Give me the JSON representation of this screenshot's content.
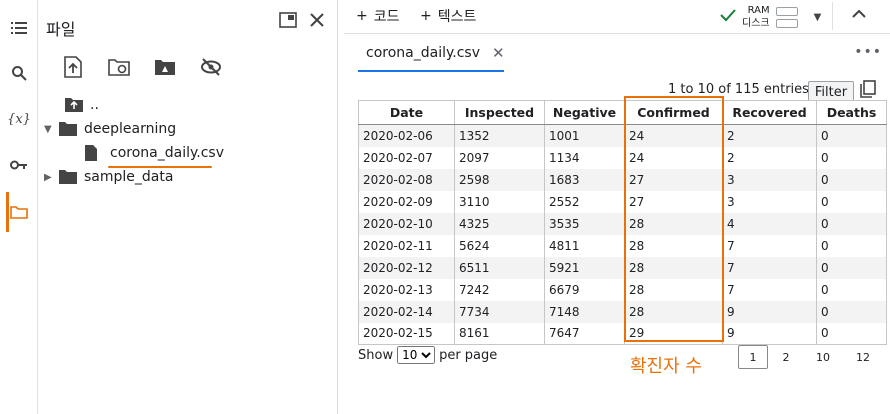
{
  "rail": {
    "icons": [
      "list-icon",
      "search-icon",
      "variables-icon",
      "key-icon",
      "folder-icon"
    ],
    "variables_label": "{x}",
    "accent": "#e8710a"
  },
  "files": {
    "title": "파일",
    "tree": [
      {
        "label": "..",
        "type": "parent"
      },
      {
        "label": "deeplearning",
        "type": "folder",
        "expanded": true
      },
      {
        "label": "corona_daily.csv",
        "type": "file"
      },
      {
        "label": "sample_data",
        "type": "folder",
        "expanded": false
      }
    ]
  },
  "topbar": {
    "code_label": "코드",
    "text_label": "텍스트",
    "ram_label": "RAM",
    "disk_label": "디스크"
  },
  "tab": {
    "label": "corona_daily.csv"
  },
  "table": {
    "entries_text": "1 to 10 of 115 entries",
    "filter_label": "Filter",
    "columns": [
      "Date",
      "Inspected",
      "Negative",
      "Confirmed",
      "Recovered",
      "Deaths"
    ],
    "rows": [
      [
        "2020-02-06",
        "1352",
        "1001",
        "24",
        "2",
        "0"
      ],
      [
        "2020-02-07",
        "2097",
        "1134",
        "24",
        "2",
        "0"
      ],
      [
        "2020-02-08",
        "2598",
        "1683",
        "27",
        "3",
        "0"
      ],
      [
        "2020-02-09",
        "3110",
        "2552",
        "27",
        "3",
        "0"
      ],
      [
        "2020-02-10",
        "4325",
        "3535",
        "28",
        "4",
        "0"
      ],
      [
        "2020-02-11",
        "5624",
        "4811",
        "28",
        "7",
        "0"
      ],
      [
        "2020-02-12",
        "6511",
        "5921",
        "28",
        "7",
        "0"
      ],
      [
        "2020-02-13",
        "7242",
        "6679",
        "28",
        "7",
        "0"
      ],
      [
        "2020-02-14",
        "7734",
        "7148",
        "28",
        "9",
        "0"
      ],
      [
        "2020-02-15",
        "8161",
        "7647",
        "29",
        "9",
        "0"
      ]
    ]
  },
  "footer": {
    "show_label": "Show",
    "per_page_value": "10",
    "per_page_label": "per page",
    "pages": [
      "1",
      "2",
      "10",
      "12"
    ],
    "current_page": "1"
  },
  "annotation": {
    "text": "확진자 수",
    "color": "#e8710a"
  }
}
